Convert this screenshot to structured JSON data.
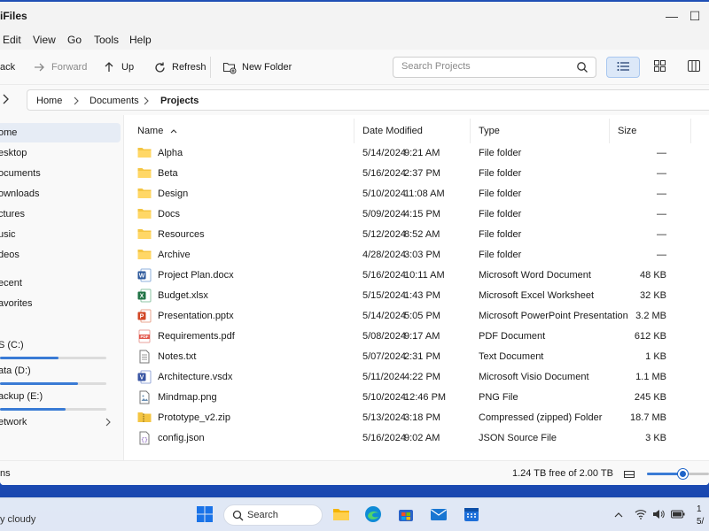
{
  "window": {
    "title": "iFiles",
    "minimize": "—",
    "maximize": "☐"
  },
  "menu": [
    "Edit",
    "View",
    "Go",
    "Tools",
    "Help"
  ],
  "toolbar": {
    "back": "ack",
    "forward": "Forward",
    "up": "Up",
    "refresh": "Refresh",
    "new_folder": "New Folder",
    "search_placeholder": "Search Projects"
  },
  "breadcrumb": [
    "Home",
    "Documents",
    "Projects"
  ],
  "sidebar": {
    "items": [
      "ome",
      "esktop",
      "ocuments",
      "ownloads",
      "ctures",
      "usic",
      "deos"
    ],
    "recent": "ecent",
    "favorites": "avorites",
    "drives": [
      {
        "label": "S (C:)",
        "used": 0.55
      },
      {
        "label": "ata (D:)",
        "used": 0.73
      },
      {
        "label": "ackup (E:)",
        "used": 0.62
      }
    ],
    "network": "etwork"
  },
  "columns": {
    "name": "Name",
    "date": "Date Modified",
    "type": "Type",
    "size": "Size"
  },
  "files": [
    {
      "name": "Alpha",
      "date": "5/14/2024",
      "time": "9:21 AM",
      "type": "File folder",
      "size": "—",
      "icon": "folder-icon"
    },
    {
      "name": "Beta",
      "date": "5/16/2024",
      "time": "2:37 PM",
      "type": "File folder",
      "size": "—",
      "icon": "folder-icon"
    },
    {
      "name": "Design",
      "date": "5/10/2024",
      "time": "11:08 AM",
      "type": "File folder",
      "size": "—",
      "icon": "folder-icon"
    },
    {
      "name": "Docs",
      "date": "5/09/2024",
      "time": "4:15 PM",
      "type": "File folder",
      "size": "—",
      "icon": "folder-icon"
    },
    {
      "name": "Resources",
      "date": "5/12/2024",
      "time": "8:52 AM",
      "type": "File folder",
      "size": "—",
      "icon": "folder-icon"
    },
    {
      "name": "Archive",
      "date": "4/28/2024",
      "time": "3:03 PM",
      "type": "File folder",
      "size": "—",
      "icon": "folder-icon"
    },
    {
      "name": "Project Plan.docx",
      "date": "5/16/2024",
      "time": "10:11 AM",
      "type": "Microsoft Word Document",
      "size": "48 KB",
      "icon": "word-icon"
    },
    {
      "name": "Budget.xlsx",
      "date": "5/15/2024",
      "time": "1:43 PM",
      "type": "Microsoft Excel Worksheet",
      "size": "32 KB",
      "icon": "excel-icon"
    },
    {
      "name": "Presentation.pptx",
      "date": "5/14/2024",
      "time": "5:05 PM",
      "type": "Microsoft PowerPoint Presentation",
      "size": "3.2 MB",
      "icon": "powerpoint-icon"
    },
    {
      "name": "Requirements.pdf",
      "date": "5/08/2024",
      "time": "9:17 AM",
      "type": "PDF Document",
      "size": "612 KB",
      "icon": "pdf-icon"
    },
    {
      "name": "Notes.txt",
      "date": "5/07/2024",
      "time": "2:31 PM",
      "type": "Text Document",
      "size": "1 KB",
      "icon": "text-file-icon"
    },
    {
      "name": "Architecture.vsdx",
      "date": "5/11/2024",
      "time": "4:22 PM",
      "type": "Microsoft Visio Document",
      "size": "1.1 MB",
      "icon": "visio-icon"
    },
    {
      "name": "Mindmap.png",
      "date": "5/10/2024",
      "time": "12:46 PM",
      "type": "PNG File",
      "size": "245 KB",
      "icon": "image-icon"
    },
    {
      "name": "Prototype_v2.zip",
      "date": "5/13/2024",
      "time": "3:18 PM",
      "type": "Compressed (zipped) Folder",
      "size": "18.7 MB",
      "icon": "zip-icon"
    },
    {
      "name": "config.json",
      "date": "5/16/2024",
      "time": "9:02 AM",
      "type": "JSON Source File",
      "size": "3 KB",
      "icon": "json-icon"
    }
  ],
  "status": {
    "left": "ns",
    "free": "1.24 TB free of 2.00 TB",
    "zoom_level": 0.6
  },
  "taskbar": {
    "weather": "y cloudy",
    "search": "Search",
    "clock_line1": "1",
    "clock_line2": "5/"
  },
  "colors": {
    "accent": "#1e64c8",
    "folder": "#f4c542",
    "word": "#2b579a",
    "excel": "#217346",
    "powerpoint": "#d24726",
    "pdf": "#e2574c",
    "visio": "#3955a3"
  }
}
